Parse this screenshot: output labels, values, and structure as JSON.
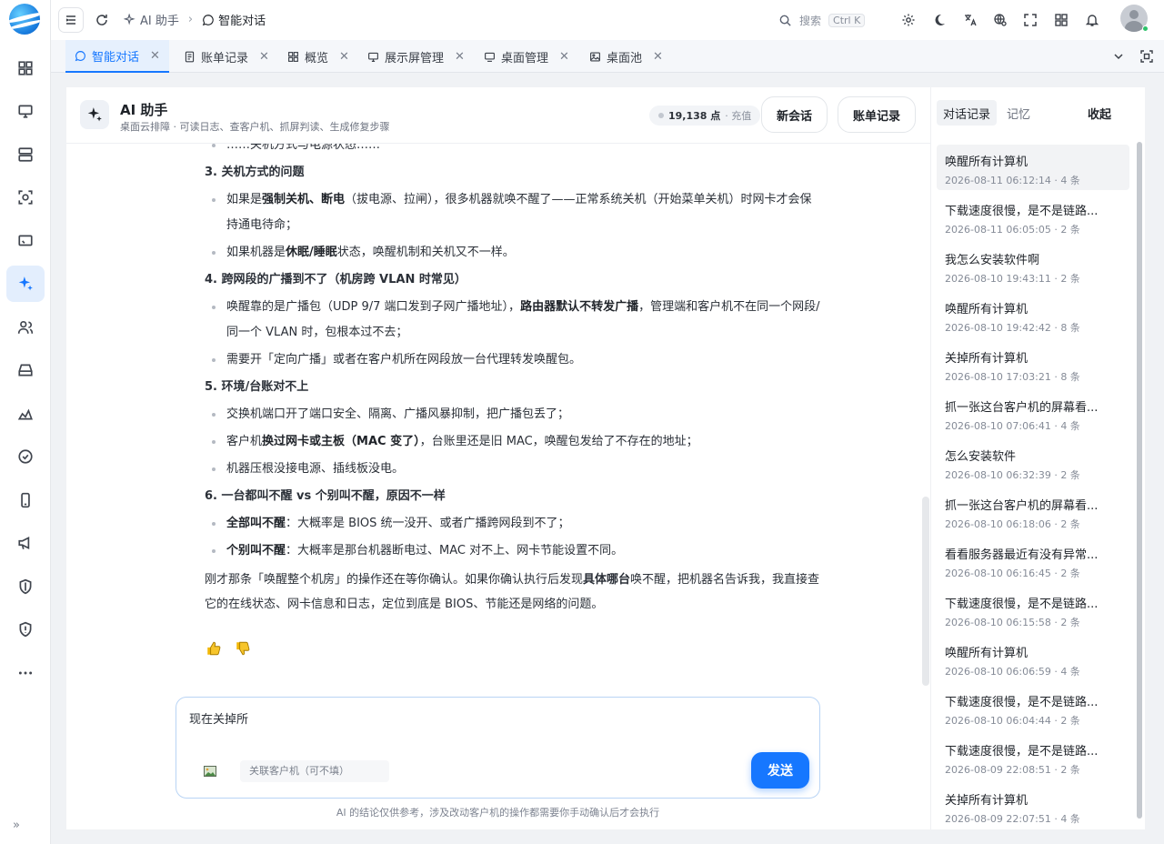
{
  "topbar": {
    "crumb_parent": "AI 助手",
    "crumb_current": "智能对话",
    "search_label": "搜索",
    "search_shortcut": "Ctrl K"
  },
  "tabs": [
    {
      "label": "智能对话",
      "icon": "chat-icon",
      "active": true
    },
    {
      "label": "账单记录",
      "icon": "document-icon",
      "active": false
    },
    {
      "label": "概览",
      "icon": "grid-icon",
      "active": false
    },
    {
      "label": "展示屏管理",
      "icon": "display-icon",
      "active": false
    },
    {
      "label": "桌面管理",
      "icon": "monitor-icon",
      "active": false
    },
    {
      "label": "桌面池",
      "icon": "image-icon",
      "active": false
    }
  ],
  "assistant": {
    "title": "AI 助手",
    "subtitle": "桌面云排障 · 可读日志、查客户机、抓屏判读、生成修复步骤",
    "points": "19,138 点",
    "recharge": "· 充值",
    "new_session": "新会话",
    "billing": "账单记录"
  },
  "message": {
    "truncated_line": "……关机方式与电源状态……",
    "s3_title": "3. 关机方式的问题",
    "s3_b1": [
      "如果是",
      "强制关机、断电",
      "（拔电源、拉闸），很多机器就唤不醒了——正常系统关机（开始菜单关机）时网卡才会保持通电待命；"
    ],
    "s3_b2": [
      "如果机器是",
      "休眠/睡眠",
      "状态，唤醒机制和关机又不一样。"
    ],
    "s4_title": "4. 跨网段的广播到不了（机房跨 VLAN 时常见）",
    "s4_b1": [
      "唤醒靠的是广播包（UDP 9/7 端口发到子网广播地址），",
      "路由器默认不转发广播",
      "，管理端和客户机不在同一个网段/同一个 VLAN 时，包根本过不去；"
    ],
    "s4_b2": "需要开「定向广播」或者在客户机所在网段放一台代理转发唤醒包。",
    "s5_title": "5. 环境/台账对不上",
    "s5_b1": "交换机端口开了端口安全、隔离、广播风暴抑制，把广播包丢了；",
    "s5_b2": [
      "客户机",
      "换过网卡或主板（MAC 变了）",
      "，台账里还是旧 MAC，唤醒包发给了不存在的地址；"
    ],
    "s5_b3": "机器压根没接电源、插线板没电。",
    "s6_title": "6. 一台都叫不醒 vs 个别叫不醒，原因不一样",
    "s6_b1": [
      "全部叫不醒",
      "：大概率是 BIOS 统一没开、或者广播跨网段到不了；"
    ],
    "s6_b2": [
      "个别叫不醒",
      "：大概率是那台机器断电过、MAC 对不上、网卡节能设置不同。"
    ],
    "closing": [
      "刚才那条「唤醒整个机房」的操作还在等你确认。如果你确认执行后发现",
      "具体哪台",
      "唤不醒，把机器名告诉我，我直接查它的在线状态、网卡信息和日志，定位到底是 BIOS、节能还是网络的问题。"
    ]
  },
  "composer": {
    "input_value": "现在关掉所",
    "bind_placeholder": "关联客户机（可不填）",
    "send": "发送",
    "disclaimer": "AI 的结论仅供参考，涉及改动客户机的操作都需要你手动确认后才会执行"
  },
  "sidebar": {
    "tab_history": "对话记录",
    "tab_memory": "记忆",
    "collapse": "收起",
    "history": [
      {
        "title": "唤醒所有计算机",
        "meta": "2026-08-11 06:12:14 · 4 条"
      },
      {
        "title": "下载速度很慢，是不是链路...",
        "meta": "2026-08-11 06:05:05 · 2 条"
      },
      {
        "title": "我怎么安装软件啊",
        "meta": "2026-08-10 19:43:11 · 2 条"
      },
      {
        "title": "唤醒所有计算机",
        "meta": "2026-08-10 19:42:42 · 8 条"
      },
      {
        "title": "关掉所有计算机",
        "meta": "2026-08-10 17:03:21 · 8 条"
      },
      {
        "title": "抓一张这台客户机的屏幕看...",
        "meta": "2026-08-10 07:06:41 · 4 条"
      },
      {
        "title": "怎么安装软件",
        "meta": "2026-08-10 06:32:39 · 2 条"
      },
      {
        "title": "抓一张这台客户机的屏幕看...",
        "meta": "2026-08-10 06:18:06 · 2 条"
      },
      {
        "title": "看看服务器最近有没有异常...",
        "meta": "2026-08-10 06:16:45 · 2 条"
      },
      {
        "title": "下载速度很慢，是不是链路...",
        "meta": "2026-08-10 06:15:58 · 2 条"
      },
      {
        "title": "唤醒所有计算机",
        "meta": "2026-08-10 06:06:59 · 4 条"
      },
      {
        "title": "下载速度很慢，是不是链路...",
        "meta": "2026-08-10 06:04:44 · 2 条"
      },
      {
        "title": "下载速度很慢，是不是链路...",
        "meta": "2026-08-09 22:08:51 · 2 条"
      },
      {
        "title": "关掉所有计算机",
        "meta": "2026-08-09 22:07:51 · 4 条"
      }
    ]
  },
  "colors": {
    "accent": "#1677ff",
    "active_bg": "#e3eefd",
    "online": "#2ec26b"
  }
}
